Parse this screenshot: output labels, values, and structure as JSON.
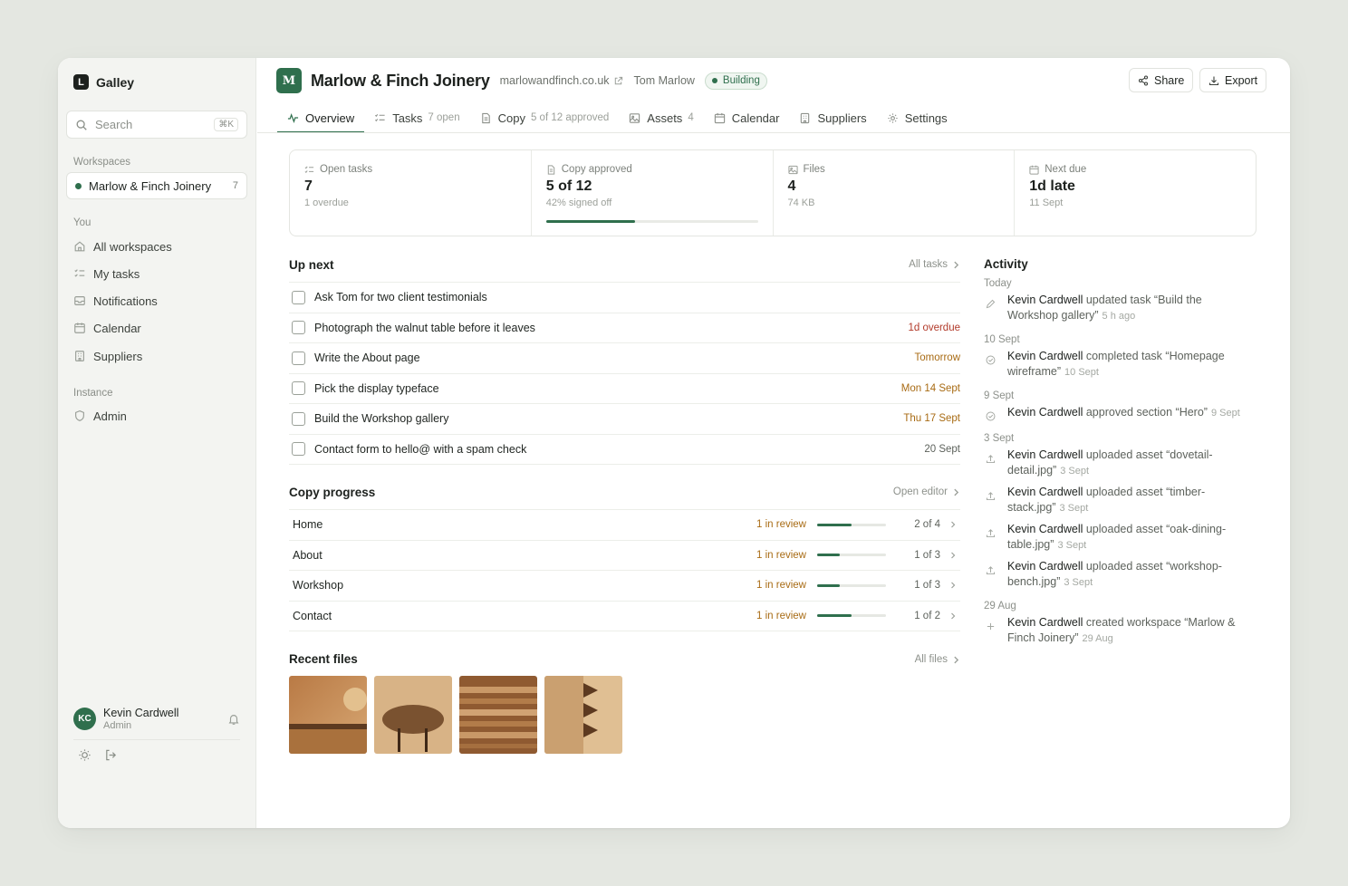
{
  "app": {
    "brand_letter": "L",
    "brand_name": "Galley"
  },
  "search": {
    "placeholder": "Search",
    "shortcut": "⌘K"
  },
  "sidebar": {
    "workspaces_heading": "Workspaces",
    "workspace": {
      "name": "Marlow & Finch Joinery",
      "count": "7"
    },
    "you_heading": "You",
    "you_items": [
      {
        "label": "All workspaces",
        "icon": "home-icon"
      },
      {
        "label": "My tasks",
        "icon": "list-check-icon"
      },
      {
        "label": "Notifications",
        "icon": "inbox-icon"
      },
      {
        "label": "Calendar",
        "icon": "calendar-icon"
      },
      {
        "label": "Suppliers",
        "icon": "building-icon"
      }
    ],
    "instance_heading": "Instance",
    "instance_items": [
      {
        "label": "Admin",
        "icon": "shield-icon"
      }
    ],
    "user": {
      "initials": "KC",
      "name": "Kevin Cardwell",
      "role": "Admin"
    }
  },
  "header": {
    "logo_letter": "M",
    "title": "Marlow & Finch Joinery",
    "url": "marlowandfinch.co.uk",
    "owner": "Tom Marlow",
    "status": "Building",
    "share_label": "Share",
    "export_label": "Export"
  },
  "tabs": [
    {
      "label": "Overview",
      "count": "",
      "icon": "activity-icon"
    },
    {
      "label": "Tasks",
      "count": "7 open",
      "icon": "list-check-icon"
    },
    {
      "label": "Copy",
      "count": "5 of 12 approved",
      "icon": "document-icon"
    },
    {
      "label": "Assets",
      "count": "4",
      "icon": "image-icon"
    },
    {
      "label": "Calendar",
      "count": "",
      "icon": "calendar-icon"
    },
    {
      "label": "Suppliers",
      "count": "",
      "icon": "building-icon"
    },
    {
      "label": "Settings",
      "count": "",
      "icon": "gear-icon"
    }
  ],
  "stats": [
    {
      "label": "Open tasks",
      "value": "7",
      "sub": "1 overdue",
      "icon": "list-check-icon"
    },
    {
      "label": "Copy approved",
      "value": "5 of 12",
      "sub": "42% signed off",
      "icon": "document-icon",
      "progress": 0.42
    },
    {
      "label": "Files",
      "value": "4",
      "sub": "74 KB",
      "icon": "image-icon"
    },
    {
      "label": "Next due",
      "value": "1d late",
      "sub": "11 Sept",
      "icon": "calendar-icon"
    }
  ],
  "up_next": {
    "title": "Up next",
    "link": "All tasks",
    "tasks": [
      {
        "text": "Ask Tom for two client testimonials",
        "due": "",
        "due_color": "#5d625c"
      },
      {
        "text": "Photograph the walnut table before it leaves",
        "due": "1d overdue",
        "due_color": "#b23a2a"
      },
      {
        "text": "Write the About page",
        "due": "Tomorrow",
        "due_color": "#a86b14"
      },
      {
        "text": "Pick the display typeface",
        "due": "Mon 14 Sept",
        "due_color": "#a86b14"
      },
      {
        "text": "Build the Workshop gallery",
        "due": "Thu 17 Sept",
        "due_color": "#a86b14"
      },
      {
        "text": "Contact form to hello@ with a spam check",
        "due": "20 Sept",
        "due_color": "#5d625c"
      }
    ]
  },
  "copy_progress": {
    "title": "Copy progress",
    "link": "Open editor",
    "pages": [
      {
        "name": "Home",
        "status": "1 in review",
        "count": "2 of 4",
        "progress": 0.5
      },
      {
        "name": "About",
        "status": "1 in review",
        "count": "1 of 3",
        "progress": 0.333
      },
      {
        "name": "Workshop",
        "status": "1 in review",
        "count": "1 of 3",
        "progress": 0.333
      },
      {
        "name": "Contact",
        "status": "1 in review",
        "count": "1 of 2",
        "progress": 0.5
      }
    ]
  },
  "recent_files": {
    "title": "Recent files",
    "link": "All files",
    "files": [
      {
        "name": "workshop-bench.jpg"
      },
      {
        "name": "oak-dining-table.jpg"
      },
      {
        "name": "timber-stack.jpg"
      },
      {
        "name": "dovetail-detail.jpg"
      }
    ]
  },
  "activity": {
    "title": "Activity",
    "groups": [
      {
        "date": "Today",
        "items": [
          {
            "actor": "Kevin Cardwell",
            "action": "updated task “Build the Workshop gallery”",
            "time": "5 h ago",
            "icon": "pencil-icon"
          }
        ]
      },
      {
        "date": "10 Sept",
        "items": [
          {
            "actor": "Kevin Cardwell",
            "action": "completed task “Homepage wireframe”",
            "time": "10 Sept",
            "icon": "check-circle-icon"
          }
        ]
      },
      {
        "date": "9 Sept",
        "items": [
          {
            "actor": "Kevin Cardwell",
            "action": "approved section “Hero”",
            "time": "9 Sept",
            "icon": "check-circle-icon"
          }
        ]
      },
      {
        "date": "3 Sept",
        "items": [
          {
            "actor": "Kevin Cardwell",
            "action": "uploaded asset “dovetail-detail.jpg”",
            "time": "3 Sept",
            "icon": "upload-icon"
          },
          {
            "actor": "Kevin Cardwell",
            "action": "uploaded asset “timber-stack.jpg”",
            "time": "3 Sept",
            "icon": "upload-icon"
          },
          {
            "actor": "Kevin Cardwell",
            "action": "uploaded asset “oak-dining-table.jpg”",
            "time": "3 Sept",
            "icon": "upload-icon"
          },
          {
            "actor": "Kevin Cardwell",
            "action": "uploaded asset “workshop-bench.jpg”",
            "time": "3 Sept",
            "icon": "upload-icon"
          }
        ]
      },
      {
        "date": "29 Aug",
        "items": [
          {
            "actor": "Kevin Cardwell",
            "action": "created workspace “Marlow & Finch Joinery”",
            "time": "29 Aug",
            "icon": "plus-icon"
          }
        ]
      }
    ]
  },
  "colors": {
    "accent": "#2f6f4d",
    "warning": "#a86b14",
    "danger": "#b23a2a"
  }
}
